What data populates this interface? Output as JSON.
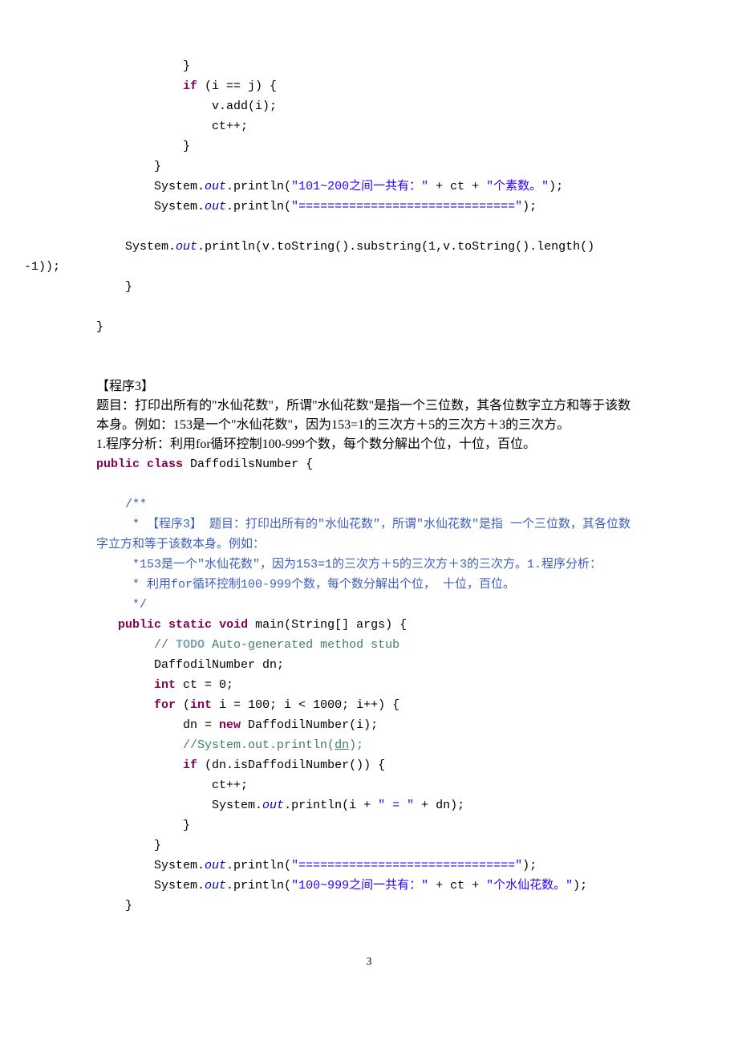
{
  "block1": {
    "l1": "            }",
    "l2a": "            ",
    "l2kw": "if",
    "l2b": " (i == j) {",
    "l3": "                v.add(i);",
    "l4": "                ct++;",
    "l5": "            }",
    "l6": "        }",
    "l7a": "        System.",
    "l7it": "out",
    "l7b": ".println(",
    "l7s1": "\"101~200之间一共有：\"",
    "l7c": " + ct + ",
    "l7s2": "\"个素数。\"",
    "l7d": ");",
    "l8a": "        System.",
    "l8it": "out",
    "l8b": ".println(",
    "l8s": "\"==============================\"",
    "l8c": ");",
    "l9a": "    System.",
    "l9it": "out",
    "l9b": ".println(v.toString().substring(1,v.toString().length()",
    "l10": "-1));",
    "l11": "    }",
    "l12": "}"
  },
  "prose": {
    "p1": "【程序3】",
    "p2": "题目：打印出所有的\"水仙花数\"，所谓\"水仙花数\"是指一个三位数，其各位数字立方和等于该数本身。例如：153是一个\"水仙花数\"，因为153=1的三次方＋5的三次方＋3的三次方。",
    "p3": "1.程序分析：利用for循环控制100-999个数，每个数分解出个位，十位，百位。"
  },
  "block2": {
    "l1a": "public",
    "l1b": " ",
    "l1c": "class",
    "l1d": " DaffodilsNumber {",
    "jd1": "    /**",
    "jd2": "     * 【程序3】 题目：打印出所有的\"水仙花数\"，所谓\"水仙花数\"是指 一个三位数，其各位数字立方和等于该数本身。例如：",
    "jd3": "     *153是一个\"水仙花数\"，因为153=1的三次方＋5的三次方＋3的三次方。1.程序分析：",
    "jd4": "     * 利用for循环控制100-999个数，每个数分解出个位， 十位，百位。",
    "jd5": "     */",
    "m1a": "   public",
    "m1b": " ",
    "m1c": "static",
    "m1d": " ",
    "m1e": "void",
    "m1f": " main(String[] args) {",
    "m2a": "        ",
    "m2b": "// ",
    "m2todo": "TODO",
    "m2c": " Auto-generated method stub",
    "m3": "        DaffodilNumber dn;",
    "m4a": "        ",
    "m4kw": "int",
    "m4b": " ct = 0;",
    "m5a": "        ",
    "m5kw1": "for",
    "m5b": " (",
    "m5kw2": "int",
    "m5c": " i = 100; i < 1000; i++) {",
    "m6a": "            dn = ",
    "m6kw": "new",
    "m6b": " DaffodilNumber(i);",
    "m7a": "            ",
    "m7b": "//System.out.println(",
    "m7u": "dn",
    "m7c": ");",
    "m8a": "            ",
    "m8kw": "if",
    "m8b": " (dn.isDaffodilNumber()) {",
    "m9": "                ct++;",
    "m10a": "                System.",
    "m10it": "out",
    "m10b": ".println(i + ",
    "m10s": "\" = \"",
    "m10c": " + dn);",
    "m11": "            }",
    "m12": "        }",
    "m13a": "        System.",
    "m13it": "out",
    "m13b": ".println(",
    "m13s": "\"==============================\"",
    "m13c": ");",
    "m14a": "        System.",
    "m14it": "out",
    "m14b": ".println(",
    "m14s1": "\"100~999之间一共有：\"",
    "m14c": " + ct + ",
    "m14s2": "\"个水仙花数。\"",
    "m14d": ");",
    "m15": "    }"
  },
  "pagenum": "3"
}
